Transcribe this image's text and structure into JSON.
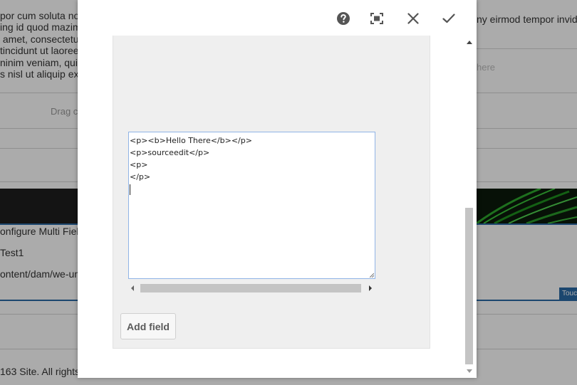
{
  "background": {
    "lorem_left": [
      "por cum soluta no",
      "ing id quod mazim",
      " amet, consectetu",
      "tincidunt ut laoree",
      "ninim veniam, quis",
      "s nisl ut aliquip ex"
    ],
    "lorem_right": [
      " ",
      "ny eirmod tempor invidu"
    ],
    "drag_hint": "Drag c",
    "placeholder_here": "here",
    "configure_label": "onfigure Multi Fiel",
    "test_label": "Test1",
    "path_label": "ontent/dam/we-un",
    "touch_badge": "Touc",
    "footer_text": "163 Site. All rights"
  },
  "dialog": {
    "toolbar": {
      "help_icon": "help-icon",
      "fullscreen_icon": "fullscreen-icon",
      "close_icon": "close-icon",
      "done_icon": "checkmark-icon"
    },
    "source_lines": [
      "<p><b>Hello There</b></p>",
      "<p>sourceedit</p>",
      "<p>",
      "</p>"
    ],
    "add_field_label": "Add field"
  },
  "colors": {
    "overlay": "rgba(0,0,0,0.33)",
    "editor_border": "#90b4e6",
    "accent_blue": "#2b6aa6"
  }
}
